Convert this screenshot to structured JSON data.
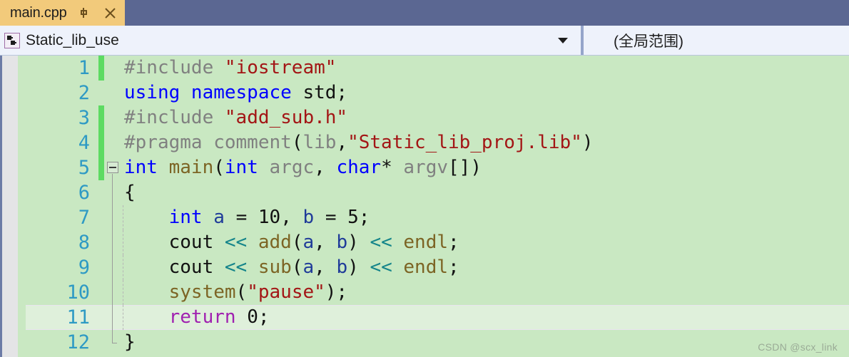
{
  "window": {
    "titlebar_color": "#5b6792"
  },
  "tab": {
    "label": "main.cpp",
    "pin_icon": "pin-icon",
    "close_icon": "close-icon",
    "active_color": "#f2ca7b"
  },
  "navbar": {
    "project_icon": "class-members-icon",
    "project_scope": "Static_lib_use",
    "dropdown_icon": "chevron-down-icon",
    "member_scope": "(全局范围)"
  },
  "editor": {
    "background_color": "#c9e8c2",
    "current_line": 11,
    "gutter_color": "#e4e4e6",
    "change_marker_color": "#5ddb62",
    "lines": [
      {
        "number": "1",
        "changed": true,
        "tokens": [
          {
            "text": "#include ",
            "cls": "t-pre"
          },
          {
            "text": "\"iostream\"",
            "cls": "t-str"
          }
        ]
      },
      {
        "number": "2",
        "changed": false,
        "tokens": [
          {
            "text": "using namespace ",
            "cls": "t-kw"
          },
          {
            "text": "std;",
            "cls": "t-plain"
          }
        ]
      },
      {
        "number": "3",
        "changed": true,
        "tokens": [
          {
            "text": "#include ",
            "cls": "t-pre"
          },
          {
            "text": "\"add_sub.h\"",
            "cls": "t-str"
          }
        ]
      },
      {
        "number": "4",
        "changed": true,
        "tokens": [
          {
            "text": "#pragma comment",
            "cls": "t-pre"
          },
          {
            "text": "(",
            "cls": "t-plain"
          },
          {
            "text": "lib",
            "cls": "t-pre"
          },
          {
            "text": ",",
            "cls": "t-plain"
          },
          {
            "text": "\"Static_lib_proj.lib\"",
            "cls": "t-str"
          },
          {
            "text": ")",
            "cls": "t-plain"
          }
        ]
      },
      {
        "number": "5",
        "changed": true,
        "tokens": [
          {
            "text": "int ",
            "cls": "t-kw"
          },
          {
            "text": "main",
            "cls": "t-fn"
          },
          {
            "text": "(",
            "cls": "t-plain"
          },
          {
            "text": "int ",
            "cls": "t-kw"
          },
          {
            "text": "argc",
            "cls": "t-var"
          },
          {
            "text": ", ",
            "cls": "t-plain"
          },
          {
            "text": "char",
            "cls": "t-kw"
          },
          {
            "text": "* ",
            "cls": "t-plain"
          },
          {
            "text": "argv",
            "cls": "t-var"
          },
          {
            "text": "[])",
            "cls": "t-plain"
          }
        ]
      },
      {
        "number": "6",
        "changed": false,
        "tokens": [
          {
            "text": "{",
            "cls": "t-plain"
          }
        ]
      },
      {
        "number": "7",
        "changed": false,
        "tokens": [
          {
            "text": "    ",
            "cls": "t-plain"
          },
          {
            "text": "int ",
            "cls": "t-kw"
          },
          {
            "text": "a ",
            "cls": "t-local"
          },
          {
            "text": "= ",
            "cls": "t-plain"
          },
          {
            "text": "10",
            "cls": "t-num"
          },
          {
            "text": ", ",
            "cls": "t-plain"
          },
          {
            "text": "b ",
            "cls": "t-local"
          },
          {
            "text": "= ",
            "cls": "t-plain"
          },
          {
            "text": "5;",
            "cls": "t-num"
          }
        ]
      },
      {
        "number": "8",
        "changed": false,
        "tokens": [
          {
            "text": "    ",
            "cls": "t-plain"
          },
          {
            "text": "cout ",
            "cls": "t-plain"
          },
          {
            "text": "<< ",
            "cls": "t-op"
          },
          {
            "text": "add",
            "cls": "t-fn"
          },
          {
            "text": "(",
            "cls": "t-plain"
          },
          {
            "text": "a",
            "cls": "t-local"
          },
          {
            "text": ", ",
            "cls": "t-plain"
          },
          {
            "text": "b",
            "cls": "t-local"
          },
          {
            "text": ") ",
            "cls": "t-plain"
          },
          {
            "text": "<< ",
            "cls": "t-op"
          },
          {
            "text": "endl",
            "cls": "t-fn"
          },
          {
            "text": ";",
            "cls": "t-plain"
          }
        ]
      },
      {
        "number": "9",
        "changed": false,
        "tokens": [
          {
            "text": "    ",
            "cls": "t-plain"
          },
          {
            "text": "cout ",
            "cls": "t-plain"
          },
          {
            "text": "<< ",
            "cls": "t-op"
          },
          {
            "text": "sub",
            "cls": "t-fn"
          },
          {
            "text": "(",
            "cls": "t-plain"
          },
          {
            "text": "a",
            "cls": "t-local"
          },
          {
            "text": ", ",
            "cls": "t-plain"
          },
          {
            "text": "b",
            "cls": "t-local"
          },
          {
            "text": ") ",
            "cls": "t-plain"
          },
          {
            "text": "<< ",
            "cls": "t-op"
          },
          {
            "text": "endl",
            "cls": "t-fn"
          },
          {
            "text": ";",
            "cls": "t-plain"
          }
        ]
      },
      {
        "number": "10",
        "changed": false,
        "tokens": [
          {
            "text": "    ",
            "cls": "t-plain"
          },
          {
            "text": "system",
            "cls": "t-fn"
          },
          {
            "text": "(",
            "cls": "t-plain"
          },
          {
            "text": "\"pause\"",
            "cls": "t-str"
          },
          {
            "text": ");",
            "cls": "t-plain"
          }
        ]
      },
      {
        "number": "11",
        "changed": false,
        "tokens": [
          {
            "text": "    ",
            "cls": "t-plain"
          },
          {
            "text": "return ",
            "cls": "t-ctl"
          },
          {
            "text": "0;",
            "cls": "t-num"
          }
        ]
      },
      {
        "number": "12",
        "changed": false,
        "tokens": [
          {
            "text": "}",
            "cls": "t-plain"
          }
        ]
      }
    ]
  },
  "watermark": {
    "text": "CSDN @scx_link"
  }
}
